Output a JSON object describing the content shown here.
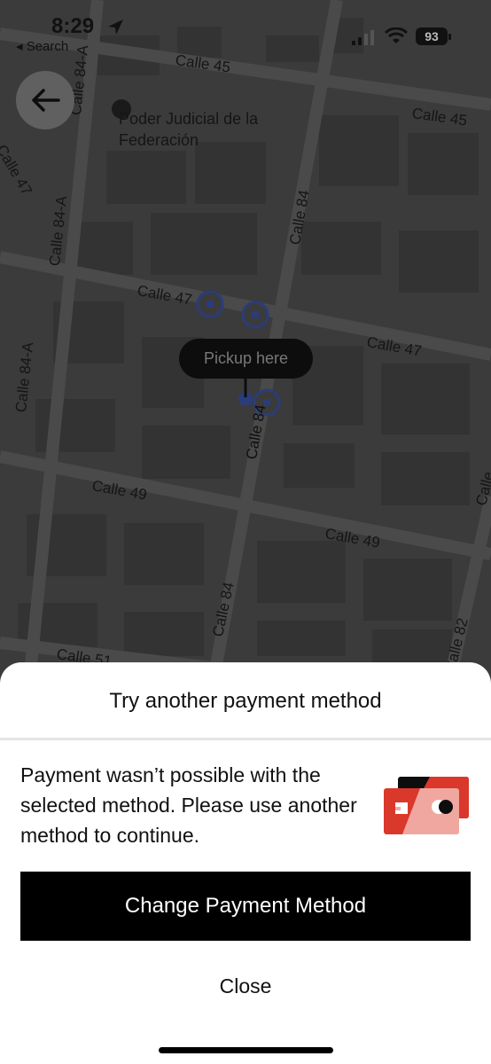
{
  "status_bar": {
    "time": "8:29",
    "back_app": "◂ Search",
    "battery": "93"
  },
  "map": {
    "poi_label": "Poder Judicial de la Federación",
    "pickup_label": "Pickup here",
    "streets": [
      "Calle 45",
      "Calle 45",
      "Calle 84-A",
      "Calle 47",
      "Calle 84-A",
      "Calle 84",
      "Calle 47",
      "Calle 47",
      "Calle 84-A",
      "Calle 49",
      "Calle 49",
      "Calle 84",
      "Calle 51",
      "Calle 82",
      "Calle 84",
      "Calle"
    ]
  },
  "sheet": {
    "title": "Try another payment method",
    "message": "Payment wasn’t possible with the selected method. Please use another method to continue.",
    "primary_button": "Change Payment Method",
    "secondary_button": "Close"
  },
  "colors": {
    "map_overlay": "#3a3a3a",
    "card_red": "#d9382b",
    "card_pink": "#f0a79f",
    "pin_blue": "#2a3c7a"
  }
}
